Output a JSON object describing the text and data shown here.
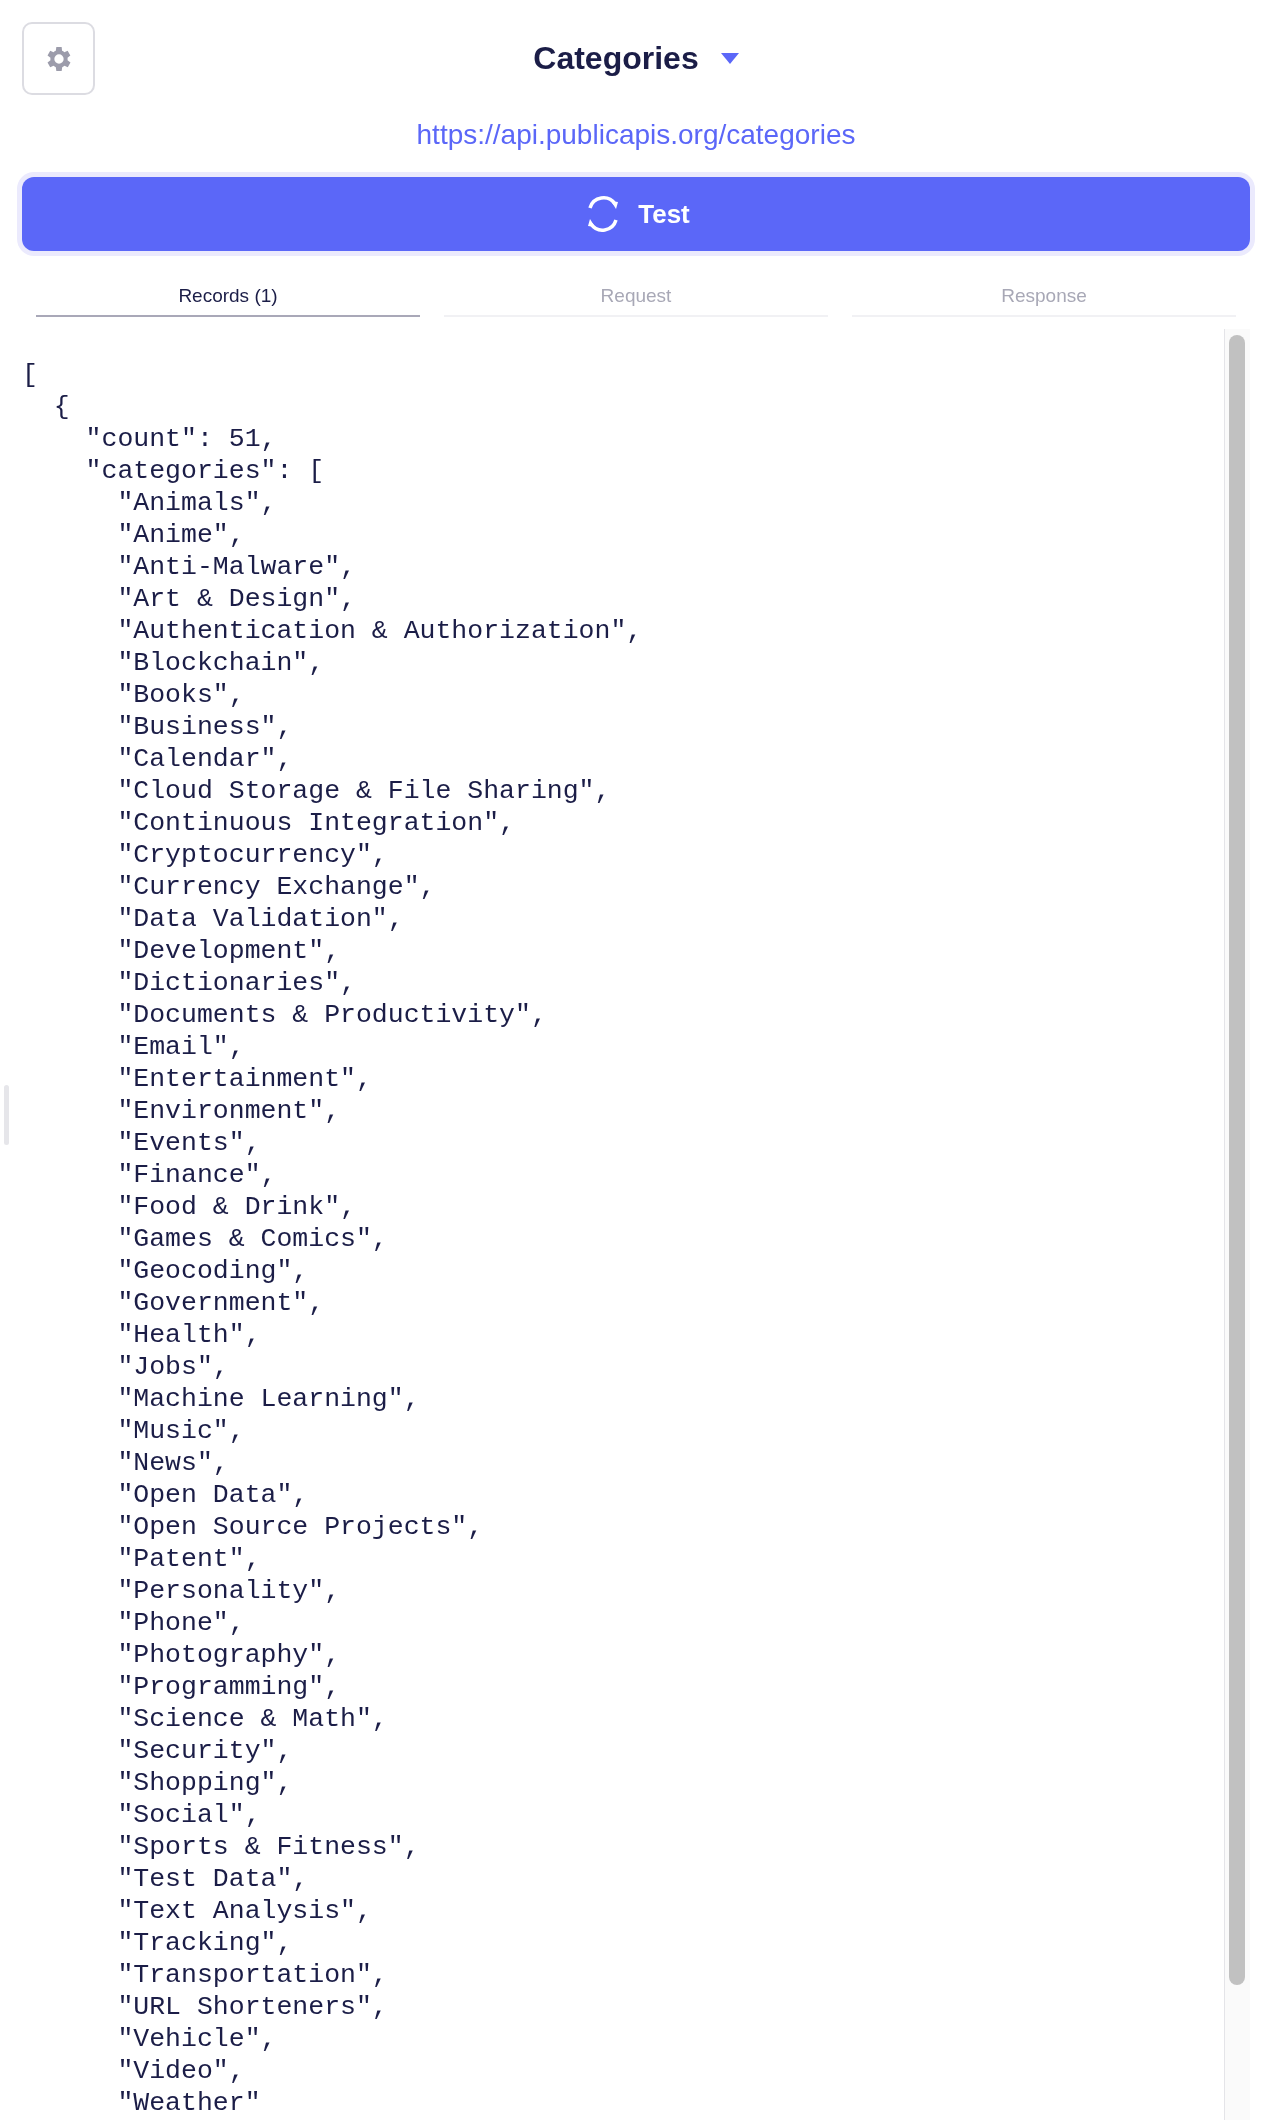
{
  "header": {
    "title": "Categories",
    "url": "https://api.publicapis.org/categories"
  },
  "test_button": {
    "label": "Test"
  },
  "tabs": [
    {
      "label": "Records (1)",
      "selected": true
    },
    {
      "label": "Request",
      "selected": false
    },
    {
      "label": "Response",
      "selected": false
    }
  ],
  "code_lines": [
    "[",
    "  {",
    "    \"count\": 51,",
    "    \"categories\": [",
    "      \"Animals\",",
    "      \"Anime\",",
    "      \"Anti-Malware\",",
    "      \"Art & Design\",",
    "      \"Authentication & Authorization\",",
    "      \"Blockchain\",",
    "      \"Books\",",
    "      \"Business\",",
    "      \"Calendar\",",
    "      \"Cloud Storage & File Sharing\",",
    "      \"Continuous Integration\",",
    "      \"Cryptocurrency\",",
    "      \"Currency Exchange\",",
    "      \"Data Validation\",",
    "      \"Development\",",
    "      \"Dictionaries\",",
    "      \"Documents & Productivity\",",
    "      \"Email\",",
    "      \"Entertainment\",",
    "      \"Environment\",",
    "      \"Events\",",
    "      \"Finance\",",
    "      \"Food & Drink\",",
    "      \"Games & Comics\",",
    "      \"Geocoding\",",
    "      \"Government\",",
    "      \"Health\",",
    "      \"Jobs\",",
    "      \"Machine Learning\",",
    "      \"Music\",",
    "      \"News\",",
    "      \"Open Data\",",
    "      \"Open Source Projects\",",
    "      \"Patent\",",
    "      \"Personality\",",
    "      \"Phone\",",
    "      \"Photography\",",
    "      \"Programming\",",
    "      \"Science & Math\",",
    "      \"Security\",",
    "      \"Shopping\",",
    "      \"Social\",",
    "      \"Sports & Fitness\",",
    "      \"Test Data\",",
    "      \"Text Analysis\",",
    "      \"Tracking\",",
    "      \"Transportation\",",
    "      \"URL Shorteners\",",
    "      \"Vehicle\",",
    "      \"Video\",",
    "      \"Weather\""
  ]
}
